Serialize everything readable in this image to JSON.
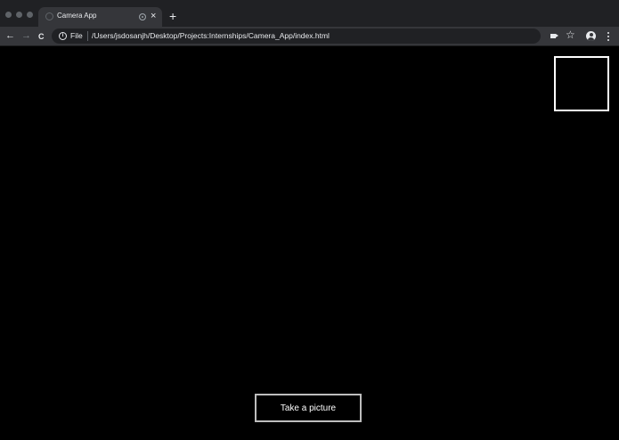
{
  "browser": {
    "tab": {
      "title": "Camera App",
      "close_icon": "×"
    },
    "new_tab_icon": "+",
    "toolbar": {
      "back_icon": "←",
      "forward_icon": "→",
      "reload_icon": "C",
      "scheme_label": "File",
      "url": "/Users/jsdosanjh/Desktop/Projects:Internships/Camera_App/index.html",
      "info_icon": "i",
      "star_icon": "☆"
    }
  },
  "page": {
    "take_picture_label": "Take a picture"
  }
}
